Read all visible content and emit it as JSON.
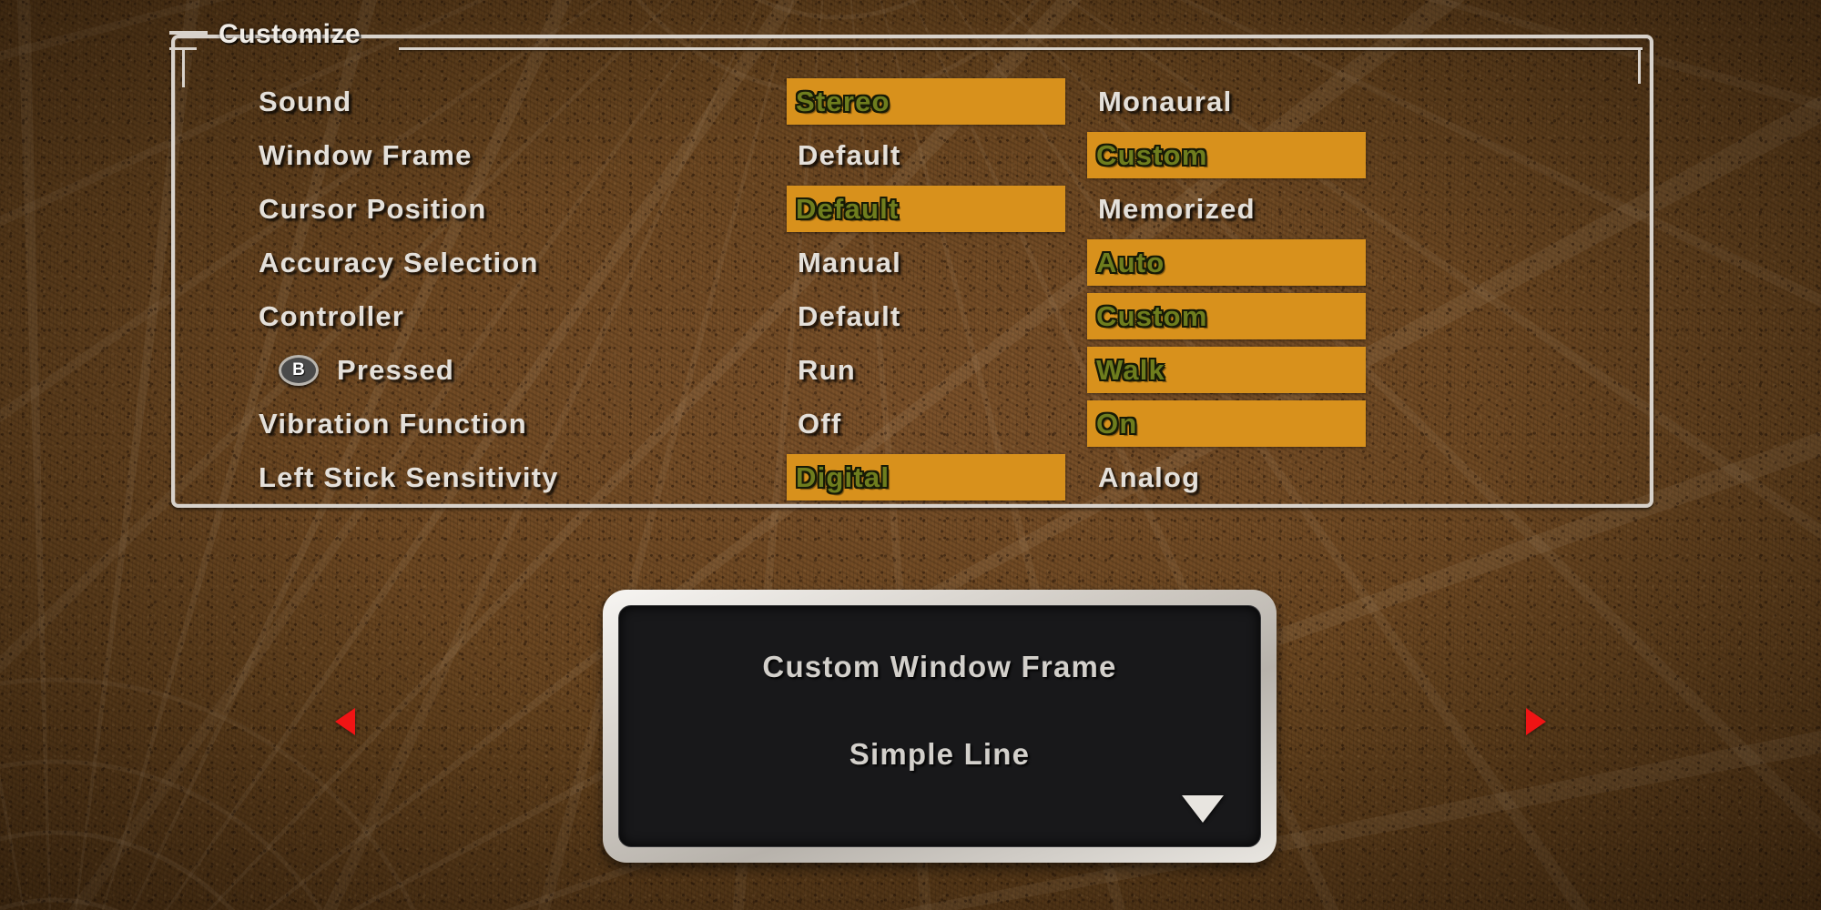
{
  "panel": {
    "title": "Customize",
    "rows": [
      {
        "label": "Sound",
        "indented": false,
        "icon": null,
        "choices": [
          {
            "text": "Stereo",
            "selected": true
          },
          {
            "text": "Monaural",
            "selected": false
          }
        ]
      },
      {
        "label": "Window Frame",
        "indented": false,
        "icon": null,
        "choices": [
          {
            "text": "Default",
            "selected": false
          },
          {
            "text": "Custom",
            "selected": true
          }
        ]
      },
      {
        "label": "Cursor Position",
        "indented": false,
        "icon": null,
        "choices": [
          {
            "text": "Default",
            "selected": true
          },
          {
            "text": "Memorized",
            "selected": false
          }
        ]
      },
      {
        "label": "Accuracy Selection",
        "indented": false,
        "icon": null,
        "choices": [
          {
            "text": "Manual",
            "selected": false
          },
          {
            "text": "Auto",
            "selected": true
          }
        ]
      },
      {
        "label": "Controller",
        "indented": false,
        "icon": null,
        "choices": [
          {
            "text": "Default",
            "selected": false
          },
          {
            "text": "Custom",
            "selected": true
          }
        ]
      },
      {
        "label": "Pressed",
        "indented": true,
        "icon": "b-button-icon",
        "icon_label": "B",
        "choices": [
          {
            "text": "Run",
            "selected": false
          },
          {
            "text": "Walk",
            "selected": true
          }
        ]
      },
      {
        "label": "Vibration Function",
        "indented": false,
        "icon": null,
        "choices": [
          {
            "text": "Off",
            "selected": false
          },
          {
            "text": "On",
            "selected": true
          }
        ]
      },
      {
        "label": "Left Stick Sensitivity",
        "indented": false,
        "icon": null,
        "choices": [
          {
            "text": "Digital",
            "selected": true
          },
          {
            "text": "Analog",
            "selected": false
          }
        ]
      }
    ]
  },
  "dialog": {
    "title": "Custom Window Frame",
    "value": "Simple Line",
    "next_icon": "triangle-down-icon"
  },
  "nav": {
    "left_icon": "triangle-left-icon",
    "right_icon": "triangle-right-icon"
  },
  "colors": {
    "highlight_bg": "#d8911c",
    "highlight_text": "#6e7d1e",
    "highlight_outline": "#171a06",
    "normal_text": "#e4e0da",
    "frame_line": "#d8d2cb",
    "nav_arrow": "#f01414",
    "dialog_bg": "#18181a",
    "dialog_border": "#cfcac3",
    "background_brown": "#5e3e20"
  }
}
